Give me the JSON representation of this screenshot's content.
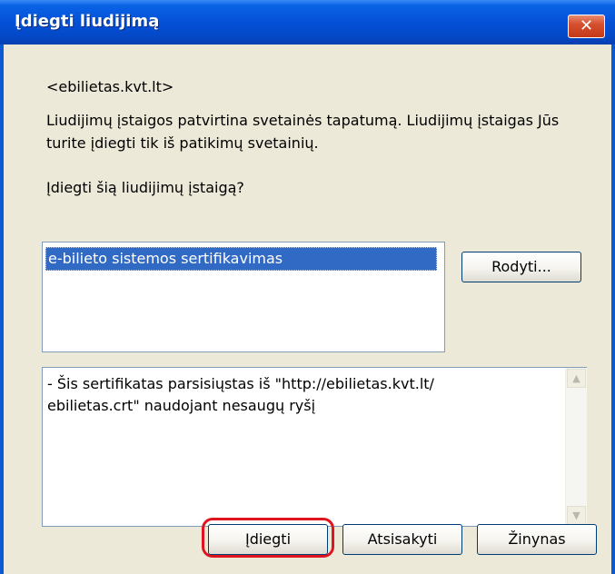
{
  "dialog": {
    "title": "Įdiegti liudijimą",
    "close_label": "✕"
  },
  "content": {
    "site": "<ebilietas.kvt.lt>",
    "description_line1": "Liudijimų įstaigos patvirtina svetainės tapatumą. Liudijimų įstaigas Jūs",
    "description_line2": "turite įdiegti tik iš patikimų svetainių.",
    "question": "Įdiegti šią liudijimų įstaigą?"
  },
  "certificate_list": {
    "items": [
      "e-bilieto sistemos sertifikavimas"
    ],
    "selected_index": 0
  },
  "buttons": {
    "view": "Rodyti...",
    "install": "Įdiegti",
    "cancel": "Atsisakyti",
    "help": "Žinynas"
  },
  "details": {
    "text": "- Šis sertifikatas parsisiųstas iš \"http://ebilietas.kvt.lt/\nebilietas.crt\" naudojant nesaugų ryšį"
  },
  "scrollbar": {
    "up_icon": "scroll-up-arrow-icon",
    "down_icon": "scroll-down-arrow-icon"
  }
}
